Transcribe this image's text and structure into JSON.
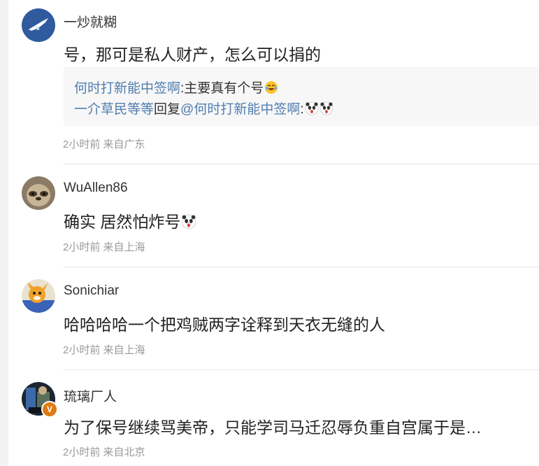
{
  "comments": [
    {
      "user": "一炒就糊",
      "text": "号，那可是私人财产，怎么可以捐的",
      "meta": "2小时前 来自广东",
      "replies": [
        {
          "user": "何时打新能中签啊",
          "sep": ":",
          "text": "主要真有个号",
          "emojis": [
            "laugh-cry-emoji"
          ]
        },
        {
          "user": "一介草民等等",
          "mid": "回复",
          "mention": "@何时打新能中签啊",
          "sep": ":",
          "emojis": [
            "panda-emoji",
            "panda-emoji"
          ]
        }
      ]
    },
    {
      "user": "WuAllen86",
      "text": "确实 居然怕炸号",
      "emojis": [
        "panda-emoji"
      ],
      "meta": "2小时前 来自上海"
    },
    {
      "user": "Sonichiar",
      "text": "哈哈哈哈一个把鸡贼两字诠释到天衣无缝的人",
      "meta": "2小时前 来自上海"
    },
    {
      "user": "琉璃厂人",
      "text": "为了保号继续骂美帝，只能学司马迁忍辱负重自宫属于是…",
      "meta": "2小时前 来自北京",
      "badge": "V"
    }
  ],
  "colors": {
    "link": "#507daf",
    "meta": "#999999",
    "verified": "#e07b12"
  }
}
